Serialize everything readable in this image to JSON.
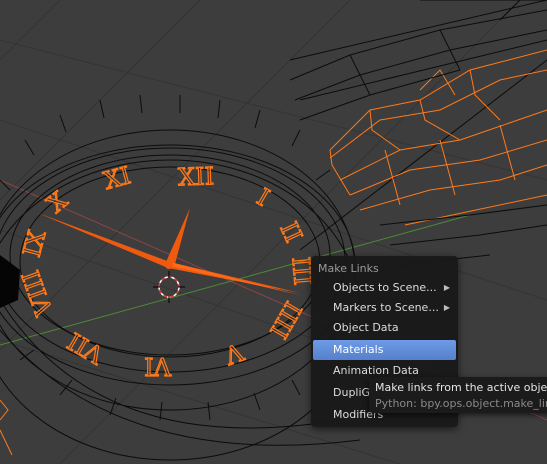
{
  "menu": {
    "title": "Make Links",
    "items": [
      {
        "label": "Objects to Scene...",
        "underline_char": "O",
        "has_submenu": true
      },
      {
        "label": "Markers to Scene...",
        "underline_char": "M",
        "has_submenu": true
      },
      {
        "label": "Object Data",
        "underline_char": "",
        "has_submenu": false
      },
      {
        "label": "Materials",
        "underline_char": "",
        "has_submenu": false,
        "active": true
      },
      {
        "label": "Animation Data",
        "underline_char": "A",
        "has_submenu": false
      },
      {
        "label": "DupliGr",
        "underline_char": "",
        "has_submenu": false
      },
      {
        "label": "Modifiers",
        "underline_char": "",
        "has_submenu": false
      }
    ]
  },
  "tooltip": {
    "description": "Make links from the active object t",
    "python": "Python: bpy.ops.object.make_links"
  },
  "clock": {
    "numerals": [
      "XII",
      "I",
      "II",
      "III",
      "IIII",
      "V",
      "VI",
      "VII",
      "VIII",
      "IX",
      "X",
      "XI"
    ]
  },
  "colors": {
    "viewport_bg": "#3d3d3d",
    "wire": "#0a0a0a",
    "selected_wire": "#ff7a1a",
    "active_orange": "#f05a0f",
    "menu_bg": "#181818",
    "menu_highlight": "#5e88d8",
    "x_axis": "#a04040",
    "y_axis": "#5a9a3a"
  }
}
